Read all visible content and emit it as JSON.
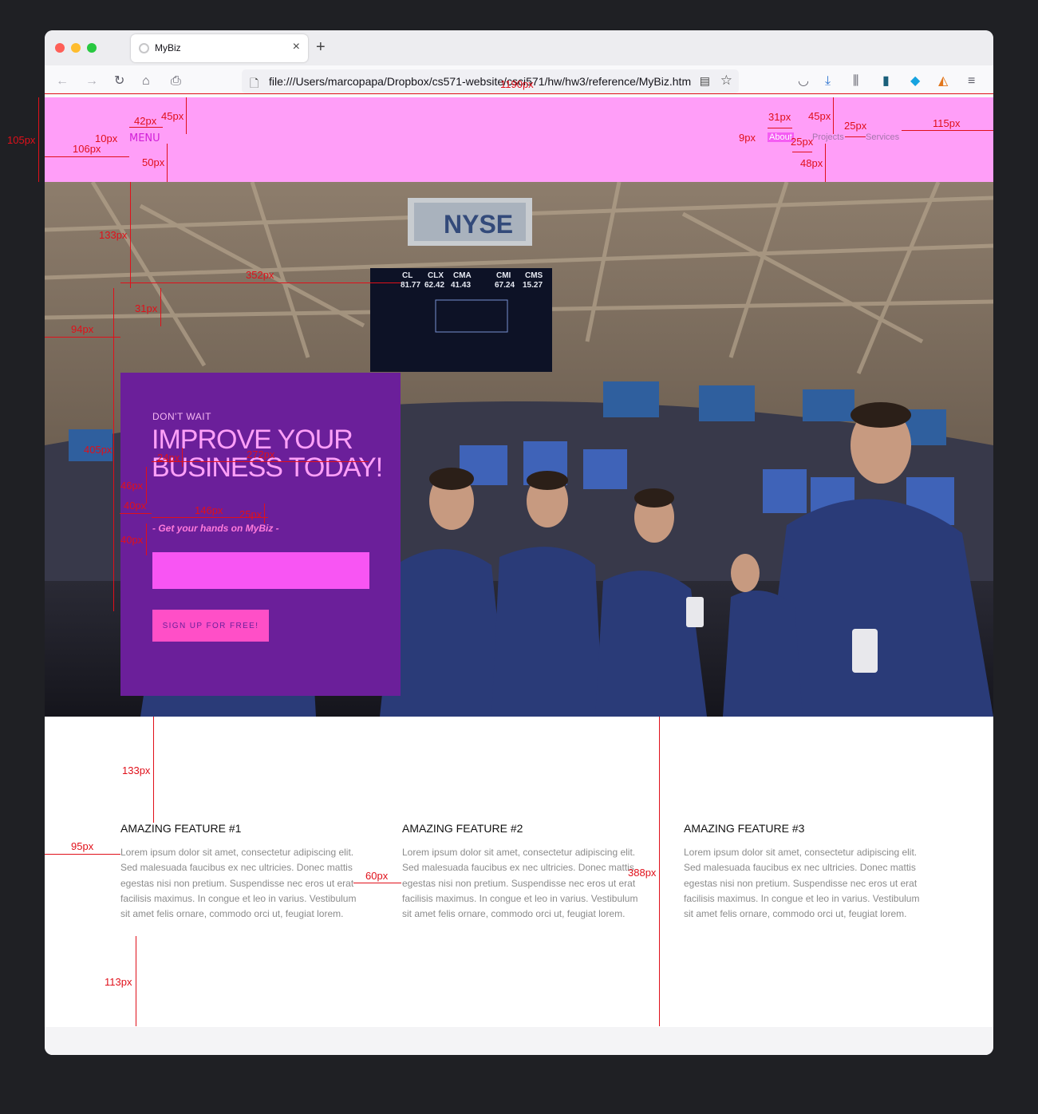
{
  "browser": {
    "tab_title": "MyBiz",
    "new_tab_label": "+",
    "url": "file:///Users/marcopapa/Dropbox/cs571-website/csci571/hw/hw3/reference/MyBiz.html"
  },
  "header": {
    "menu_label": "MENU",
    "nav_links": [
      "About",
      "Projects",
      "Services"
    ]
  },
  "hero": {
    "eyebrow": "DON'T WAIT",
    "headline": "IMPROVE YOUR BUSINESS TODAY!",
    "tagline": "- Get your hands on MyBiz -",
    "email_value": "",
    "signup_label": "SIGN UP FOR FREE!",
    "board_labels": [
      "CL",
      "CLX",
      "CMA",
      "CMI",
      "CMS"
    ],
    "board_values": [
      "81.77",
      "62.42",
      "41.43",
      "67.24",
      "15.27"
    ],
    "sign_text": "NYSE"
  },
  "features": [
    {
      "title": "AMAZING FEATURE #1",
      "body": "Lorem ipsum dolor sit amet, consectetur adipiscing elit. Sed malesuada faucibus ex nec ultricies. Donec mattis egestas nisi non pretium. Suspendisse nec eros ut erat facilisis maximus. In congue et leo in varius. Vestibulum sit amet felis ornare, commodo orci ut, feugiat lorem."
    },
    {
      "title": "AMAZING FEATURE #2",
      "body": "Lorem ipsum dolor sit amet, consectetur adipiscing elit. Sed malesuada faucibus ex nec ultricies. Donec mattis egestas nisi non pretium. Suspendisse nec eros ut erat facilisis maximus. In congue et leo in varius. Vestibulum sit amet felis ornare, commodo orci ut, feugiat lorem."
    },
    {
      "title": "AMAZING FEATURE #3",
      "body": "Lorem ipsum dolor sit amet, consectetur adipiscing elit. Sed malesuada faucibus ex nec ultricies. Donec mattis egestas nisi non pretium. Suspendisse nec eros ut erat facilisis maximus. In congue et leo in varius. Vestibulum sit amet felis ornare, commodo orci ut, feugiat lorem."
    }
  ],
  "annotations": [
    "1190px",
    "105px",
    "106px",
    "42px",
    "45px",
    "10px",
    "50px",
    "31px",
    "45px",
    "9px",
    "25px",
    "25px",
    "48px",
    "115px",
    "133px",
    "352px",
    "31px",
    "94px",
    "405px",
    "24px",
    "272px",
    "46px",
    "40px",
    "146px",
    "25px",
    "40px",
    "133px",
    "95px",
    "60px",
    "388px",
    "113px"
  ],
  "colors": {
    "header_bg": "#ff9ef8",
    "cta_box": "#6b1f9a",
    "input_bg": "#f855f3",
    "button_bg": "#ff4fc7",
    "headline": "#ffa0f8",
    "annotation": "#e0101a"
  }
}
